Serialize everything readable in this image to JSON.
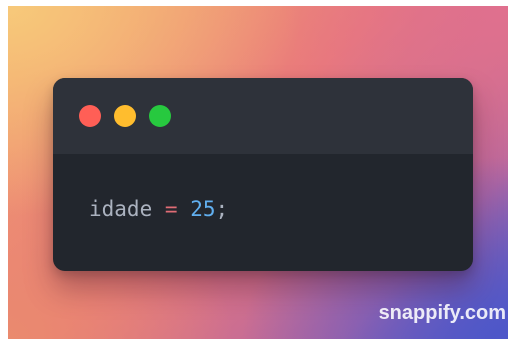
{
  "window": {
    "buttons": [
      {
        "name": "close",
        "color": "#ff5f56"
      },
      {
        "name": "minimize",
        "color": "#ffbd2e"
      },
      {
        "name": "maximize",
        "color": "#27c93f"
      }
    ]
  },
  "code": {
    "identifier": "idade",
    "operator": "=",
    "number": "25",
    "terminator": ";"
  },
  "colors": {
    "identifier": "#abb2bf",
    "operator": "#e06c75",
    "number": "#61afef",
    "window_body": "#22262d",
    "titlebar": "#2e323a"
  },
  "watermark": {
    "text": "snappify.com"
  }
}
